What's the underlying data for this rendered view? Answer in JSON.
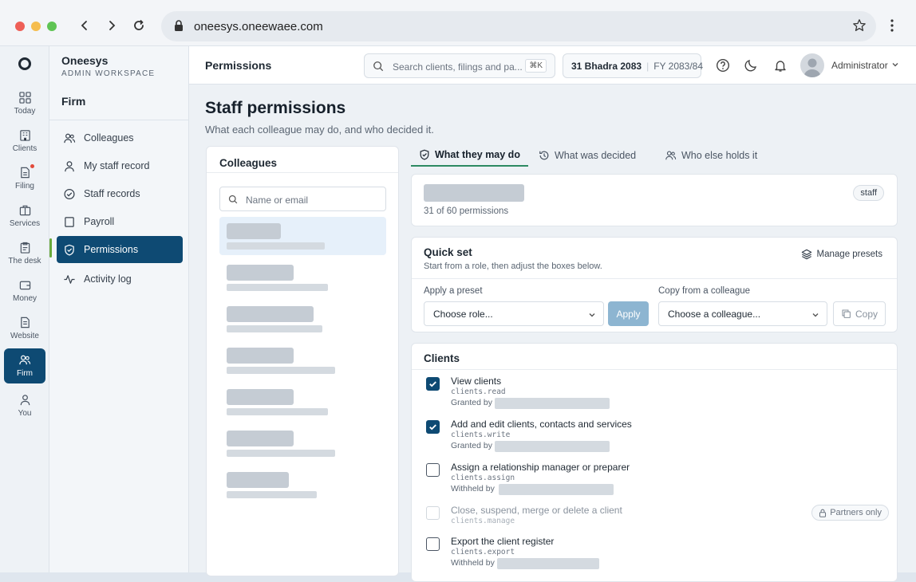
{
  "browser": {
    "url": "oneesys.oneewaee.com"
  },
  "rail": {
    "items": [
      {
        "label": "Today"
      },
      {
        "label": "Clients"
      },
      {
        "label": "Filing"
      },
      {
        "label": "Services"
      },
      {
        "label": "The desk"
      },
      {
        "label": "Money"
      },
      {
        "label": "Website"
      },
      {
        "label": "Firm",
        "active": true
      },
      {
        "label": "You"
      }
    ]
  },
  "sidebar": {
    "brand": "Oneesys",
    "brand_sub": "ADMIN WORKSPACE",
    "heading": "Firm",
    "items": [
      {
        "label": "Colleagues"
      },
      {
        "label": "My staff record"
      },
      {
        "label": "Staff records"
      },
      {
        "label": "Payroll"
      },
      {
        "label": "Permissions",
        "active": true
      },
      {
        "label": "Activity log"
      }
    ]
  },
  "header": {
    "crumb": "Permissions",
    "search_placeholder": "Search clients, filings and pa...",
    "shortcut": "⌘K",
    "date_bs": "31 Bhadra 2083",
    "fiscal_year": "FY 2083/84",
    "user": "Administrator"
  },
  "page": {
    "title": "Staff permissions",
    "subtitle": "What each colleague may do, and who decided it."
  },
  "colleagues": {
    "title": "Colleagues",
    "search_placeholder": "Name or email"
  },
  "tabs": [
    {
      "label": "What they may do",
      "active": true
    },
    {
      "label": "What was decided"
    },
    {
      "label": "Who else holds it"
    }
  ],
  "summary": {
    "count_text": "31 of 60 permissions",
    "role": "staff"
  },
  "quickset": {
    "title": "Quick set",
    "subtitle": "Start from a role, then adjust the boxes below.",
    "manage": "Manage presets",
    "preset_label": "Apply a preset",
    "preset_value": "Choose role...",
    "apply": "Apply",
    "copy_label": "Copy from a colleague",
    "copy_value": "Choose a colleague...",
    "copy_btn": "Copy"
  },
  "clients_section": {
    "title": "Clients",
    "perms": [
      {
        "label": "View clients",
        "code": "clients.read",
        "by": "Granted by",
        "checked": true
      },
      {
        "label": "Add and edit clients, contacts and services",
        "code": "clients.write",
        "by": "Granted by",
        "checked": true
      },
      {
        "label": "Assign a relationship manager or preparer",
        "code": "clients.assign",
        "by": "Withheld by",
        "checked": false
      },
      {
        "label": "Close, suspend, merge or delete a client",
        "code": "clients.manage",
        "by": "",
        "checked": false,
        "disabled": true,
        "badge": "Partners only"
      },
      {
        "label": "Export the client register",
        "code": "clients.export",
        "by": "Withheld by",
        "checked": false
      }
    ]
  },
  "colors": {
    "primary": "#0e4a73",
    "accent_green": "#2d8a62",
    "apply_disabled": "#8db5d1"
  }
}
